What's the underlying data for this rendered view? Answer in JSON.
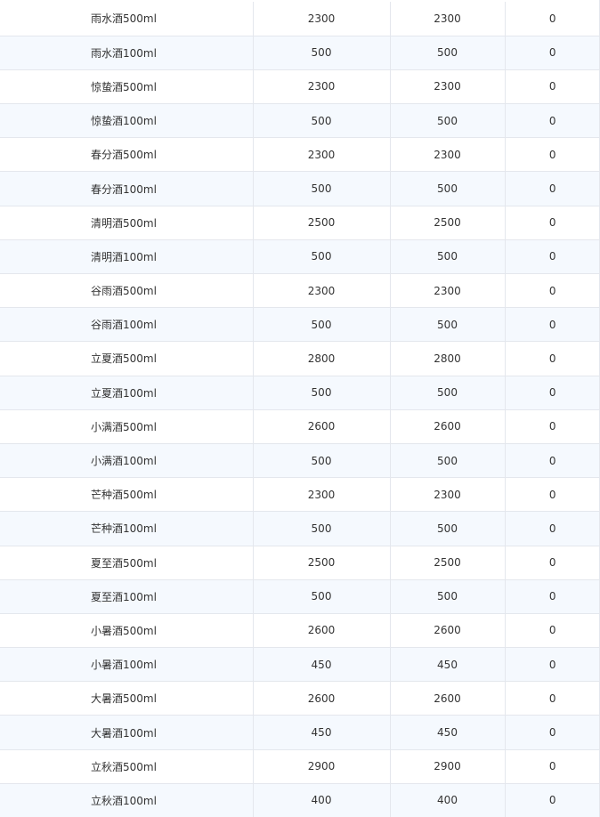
{
  "table": {
    "rows": [
      {
        "name": "雨水酒500ml",
        "a": "2300",
        "b": "2300",
        "c": "0"
      },
      {
        "name": "雨水酒100ml",
        "a": "500",
        "b": "500",
        "c": "0"
      },
      {
        "name": "惊蛰酒500ml",
        "a": "2300",
        "b": "2300",
        "c": "0"
      },
      {
        "name": "惊蛰酒100ml",
        "a": "500",
        "b": "500",
        "c": "0"
      },
      {
        "name": "春分酒500ml",
        "a": "2300",
        "b": "2300",
        "c": "0"
      },
      {
        "name": "春分酒100ml",
        "a": "500",
        "b": "500",
        "c": "0"
      },
      {
        "name": "清明酒500ml",
        "a": "2500",
        "b": "2500",
        "c": "0"
      },
      {
        "name": "清明酒100ml",
        "a": "500",
        "b": "500",
        "c": "0"
      },
      {
        "name": "谷雨酒500ml",
        "a": "2300",
        "b": "2300",
        "c": "0"
      },
      {
        "name": "谷雨酒100ml",
        "a": "500",
        "b": "500",
        "c": "0"
      },
      {
        "name": "立夏酒500ml",
        "a": "2800",
        "b": "2800",
        "c": "0"
      },
      {
        "name": "立夏酒100ml",
        "a": "500",
        "b": "500",
        "c": "0"
      },
      {
        "name": "小满酒500ml",
        "a": "2600",
        "b": "2600",
        "c": "0"
      },
      {
        "name": "小满酒100ml",
        "a": "500",
        "b": "500",
        "c": "0"
      },
      {
        "name": "芒种酒500ml",
        "a": "2300",
        "b": "2300",
        "c": "0"
      },
      {
        "name": "芒种酒100ml",
        "a": "500",
        "b": "500",
        "c": "0"
      },
      {
        "name": "夏至酒500ml",
        "a": "2500",
        "b": "2500",
        "c": "0"
      },
      {
        "name": "夏至酒100ml",
        "a": "500",
        "b": "500",
        "c": "0"
      },
      {
        "name": "小暑酒500ml",
        "a": "2600",
        "b": "2600",
        "c": "0"
      },
      {
        "name": "小暑酒100ml",
        "a": "450",
        "b": "450",
        "c": "0"
      },
      {
        "name": "大暑酒500ml",
        "a": "2600",
        "b": "2600",
        "c": "0"
      },
      {
        "name": "大暑酒100ml",
        "a": "450",
        "b": "450",
        "c": "0"
      },
      {
        "name": "立秋酒500ml",
        "a": "2900",
        "b": "2900",
        "c": "0"
      },
      {
        "name": "立秋酒100ml",
        "a": "400",
        "b": "400",
        "c": "0"
      }
    ]
  },
  "colors": {
    "row_stripe": "#f5f9fe",
    "border": "#e4e7ed",
    "text": "#333333"
  }
}
